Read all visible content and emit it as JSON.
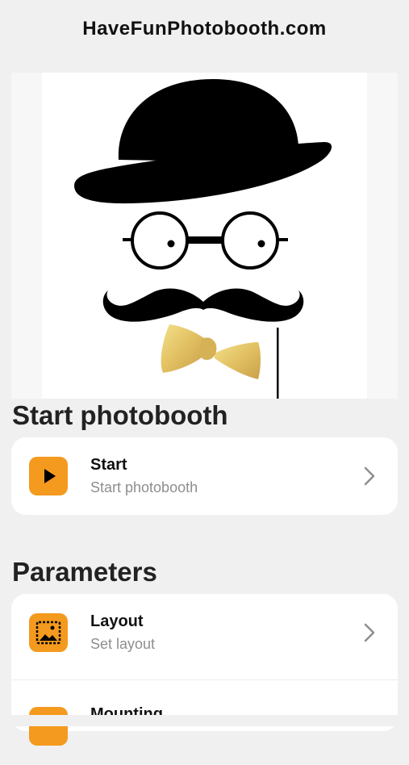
{
  "header": {
    "title": "HaveFunPhotobooth.com"
  },
  "hero": {
    "image_name": "mustache-bowler-hat-illustration"
  },
  "start_section": {
    "heading": "Start photobooth",
    "items": [
      {
        "title": "Start",
        "subtitle": "Start photobooth",
        "icon": "play-icon"
      }
    ]
  },
  "parameters_section": {
    "heading": "Parameters",
    "items": [
      {
        "title": "Layout",
        "subtitle": "Set layout",
        "icon": "layout-icon"
      },
      {
        "title": "Mounting",
        "icon": "mounting-icon"
      }
    ]
  },
  "colors": {
    "accent": "#f49a1e",
    "background": "#f0f0f0",
    "card": "#ffffff",
    "subtitle": "#8e8e8e"
  }
}
